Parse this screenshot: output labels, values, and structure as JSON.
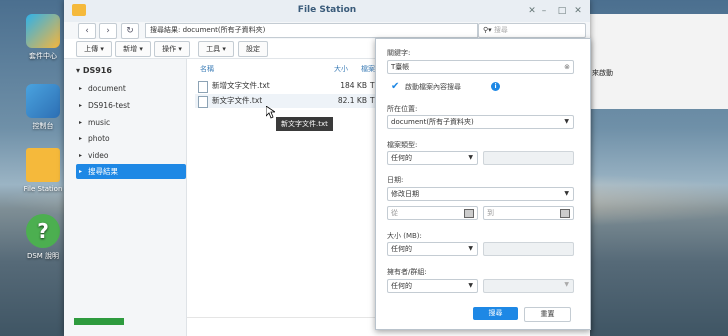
{
  "desktop": {
    "icons": [
      {
        "label": "套件中心"
      },
      {
        "label": "控制台"
      },
      {
        "label": "File Station"
      },
      {
        "label": "DSM 說明"
      }
    ],
    "right_text": "來啟動"
  },
  "window": {
    "title": "File Station",
    "path": "搜尋結果: document(所有子資料夾)",
    "search_placeholder": "搜尋",
    "toolbar": [
      "上傳",
      "新增",
      "操作",
      "工具",
      "設定"
    ],
    "tree": {
      "root": "DS916",
      "items": [
        "document",
        "DS916-test",
        "music",
        "photo",
        "video",
        "搜尋結果"
      ]
    },
    "columns": {
      "name": "名稱",
      "size": "大小",
      "type": "檔案"
    },
    "files": [
      {
        "name": "新增文字文件.txt",
        "size": "184 KB",
        "type": "TXT"
      },
      {
        "name": "新文字文件.txt",
        "size": "82.1 KB",
        "type": "TXT"
      }
    ],
    "tooltip": "新文字文件.txt"
  },
  "search_panel": {
    "keyword_label": "關鍵字:",
    "keyword_value": "T臺帳",
    "content_search_label": "啟動檔案內容搜尋",
    "location_label": "所在位置:",
    "location_value": "document(所有子資料夾)",
    "filetype_label": "檔案類型:",
    "filetype_value": "任何的",
    "date_label": "日期:",
    "date_value": "修改日期",
    "date_from_placeholder": "從",
    "date_to_placeholder": "到",
    "size_label": "大小 (MB):",
    "size_value": "任何的",
    "owner_label": "擁有者/群組:",
    "owner_value": "任何的",
    "search_button": "搜尋",
    "reset_button": "重置"
  },
  "colors": {
    "accent": "#1e88e5",
    "title": "#3a5b7a"
  }
}
